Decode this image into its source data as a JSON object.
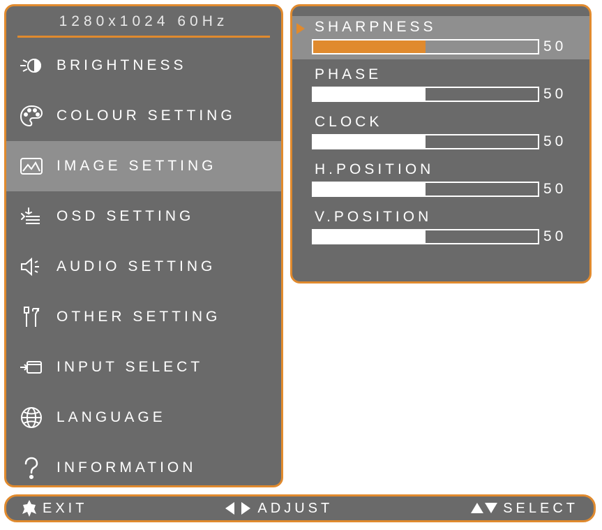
{
  "header": {
    "title": "1280x1024 60Hz"
  },
  "menu": {
    "items": [
      {
        "label": "BRIGHTNESS",
        "icon": "brightness-icon",
        "selected": false
      },
      {
        "label": "COLOUR SETTING",
        "icon": "palette-icon",
        "selected": false
      },
      {
        "label": "IMAGE SETTING",
        "icon": "image-icon",
        "selected": true
      },
      {
        "label": "OSD SETTING",
        "icon": "osd-icon",
        "selected": false
      },
      {
        "label": "AUDIO SETTING",
        "icon": "speaker-icon",
        "selected": false
      },
      {
        "label": "OTHER SETTING",
        "icon": "tools-icon",
        "selected": false
      },
      {
        "label": "INPUT SELECT",
        "icon": "input-icon",
        "selected": false
      },
      {
        "label": "LANGUAGE",
        "icon": "globe-icon",
        "selected": false
      },
      {
        "label": "INFORMATION",
        "icon": "question-icon",
        "selected": false
      }
    ]
  },
  "sliders": {
    "items": [
      {
        "label": "SHARPNESS",
        "value": 50,
        "selected": true,
        "fill": "orange"
      },
      {
        "label": "PHASE",
        "value": 50,
        "selected": false,
        "fill": "white"
      },
      {
        "label": "CLOCK",
        "value": 50,
        "selected": false,
        "fill": "white"
      },
      {
        "label": "H.POSITION",
        "value": 50,
        "selected": false,
        "fill": "white"
      },
      {
        "label": "V.POSITION",
        "value": 50,
        "selected": false,
        "fill": "white"
      }
    ]
  },
  "footer": {
    "exit": "EXIT",
    "adjust": "ADJUST",
    "select": "SELECT"
  }
}
